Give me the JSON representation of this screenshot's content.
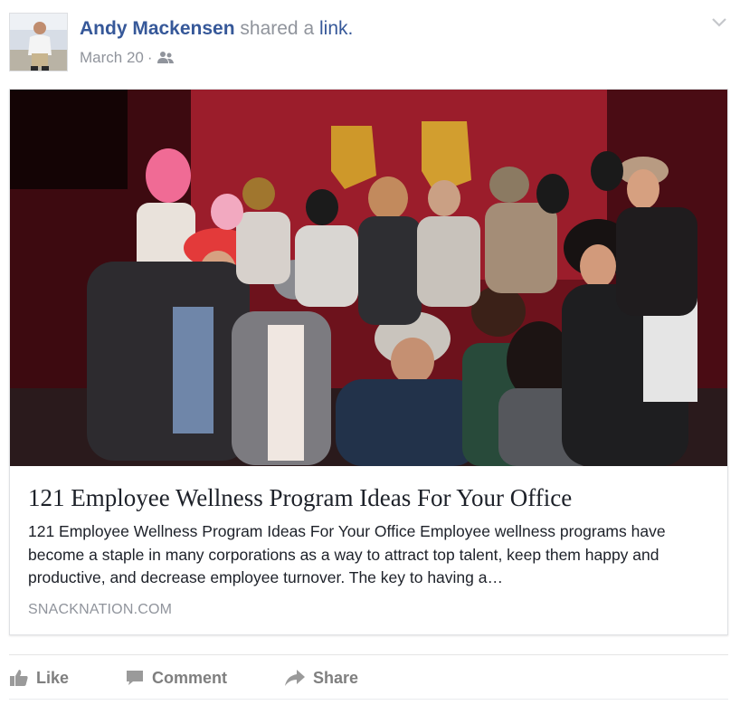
{
  "post": {
    "author": "Andy Mackensen",
    "shared_text": "shared a",
    "link_word": "link.",
    "date": "March 20",
    "separator": "·",
    "audience_icon": "friends-icon",
    "menu_icon": "chevron-down-icon"
  },
  "link_preview": {
    "image_description_icon": "party-photo",
    "title": "121 Employee Wellness Program Ideas For Your Office",
    "description": "121 Employee Wellness Program Ideas For Your Office Employee wellness programs have become a staple in many corporations as a way to attract top talent, keep them happy and productive, and decrease employee turnover. The key to having a…",
    "domain": "SNACKNATION.COM"
  },
  "actions": [
    {
      "label": "Like",
      "icon": "thumbs-up-icon"
    },
    {
      "label": "Comment",
      "icon": "comment-icon"
    },
    {
      "label": "Share",
      "icon": "share-arrow-icon"
    }
  ],
  "colors": {
    "link_blue": "#365899",
    "meta_gray": "#90949c",
    "action_gray": "#7f7f7f",
    "photo_wall": "#8b1a25"
  }
}
